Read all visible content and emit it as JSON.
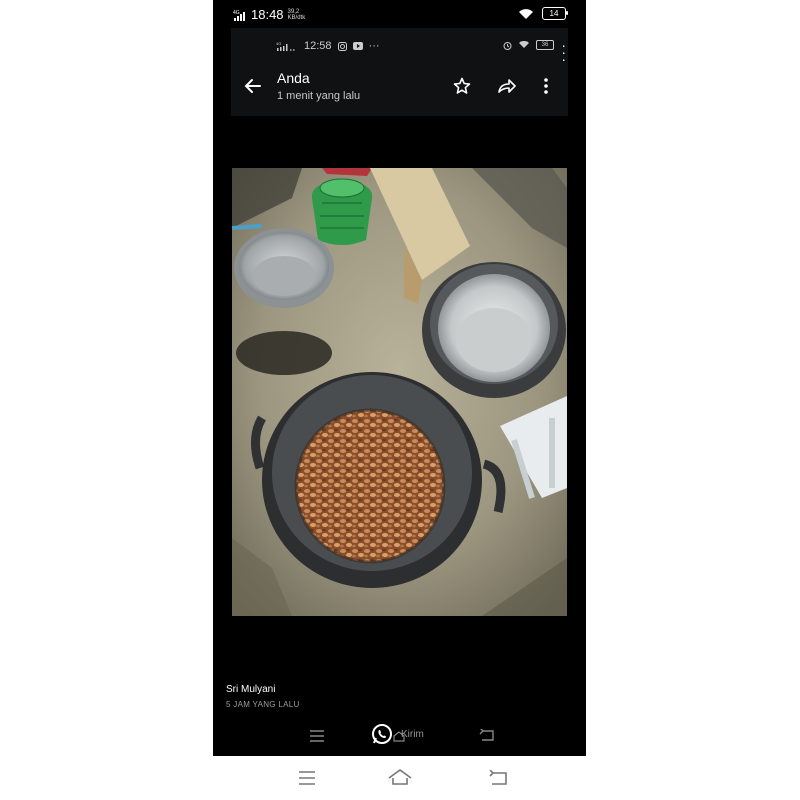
{
  "outer_status": {
    "network": "4G",
    "time": "18:48",
    "speed_value": "39,2",
    "speed_unit": "KB/dtk",
    "battery": "14"
  },
  "inner_status": {
    "network": "4G",
    "time": "12:58",
    "overflow": "···",
    "battery": "36"
  },
  "app_bar": {
    "title": "Anda",
    "subtitle": "1 menit yang lalu"
  },
  "post": {
    "author": "Sri Mulyani",
    "time": "5 JAM YANG LALU"
  },
  "inner_nav": {
    "send_label": "Kirim"
  },
  "colors": {
    "phone_bg": "#000000",
    "app_bar_bg": "#0f1113",
    "text_primary": "#ffffff",
    "text_secondary": "#c8c8c8",
    "whatsapp_icon": "#ffffff"
  },
  "icons": [
    "signal-icon",
    "wifi-icon",
    "battery-icon",
    "alarm-icon",
    "instagram-icon",
    "youtube-icon",
    "back-arrow-icon",
    "star-icon",
    "forward-icon",
    "more-vert-icon",
    "menu-icon",
    "whatsapp-icon",
    "home-icon",
    "return-icon"
  ]
}
